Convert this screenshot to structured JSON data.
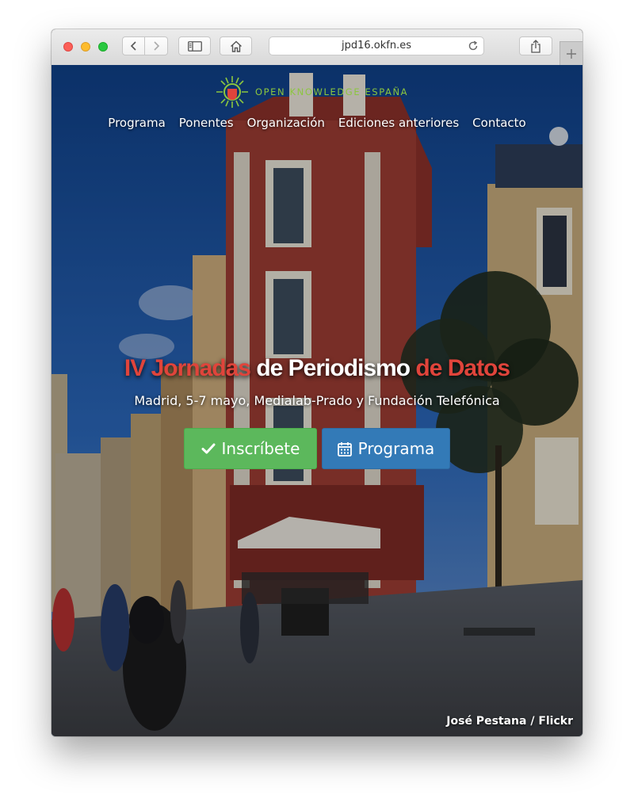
{
  "browser": {
    "url": "jpd16.okfn.es"
  },
  "brand": {
    "name": "OPEN KNOWLEDGE ESPAÑA"
  },
  "nav": {
    "items": [
      "Programa",
      "Ponentes",
      "Organización",
      "Ediciones anteriores",
      "Contacto"
    ]
  },
  "hero": {
    "title_part1": "IV Jornadas",
    "title_part2": " de Periodismo ",
    "title_part3": "de Datos",
    "subtitle": "Madrid, 5-7 mayo, Medialab-Prado y Fundación Telefónica",
    "register_label": "Inscríbete",
    "program_label": "Programa"
  },
  "photo": {
    "credit": "José Pestana / Flickr"
  },
  "colors": {
    "accent_red": "#e0443b",
    "register_green": "#5cb85c",
    "program_blue": "#337ab7",
    "brand_green": "#8cc63f"
  }
}
